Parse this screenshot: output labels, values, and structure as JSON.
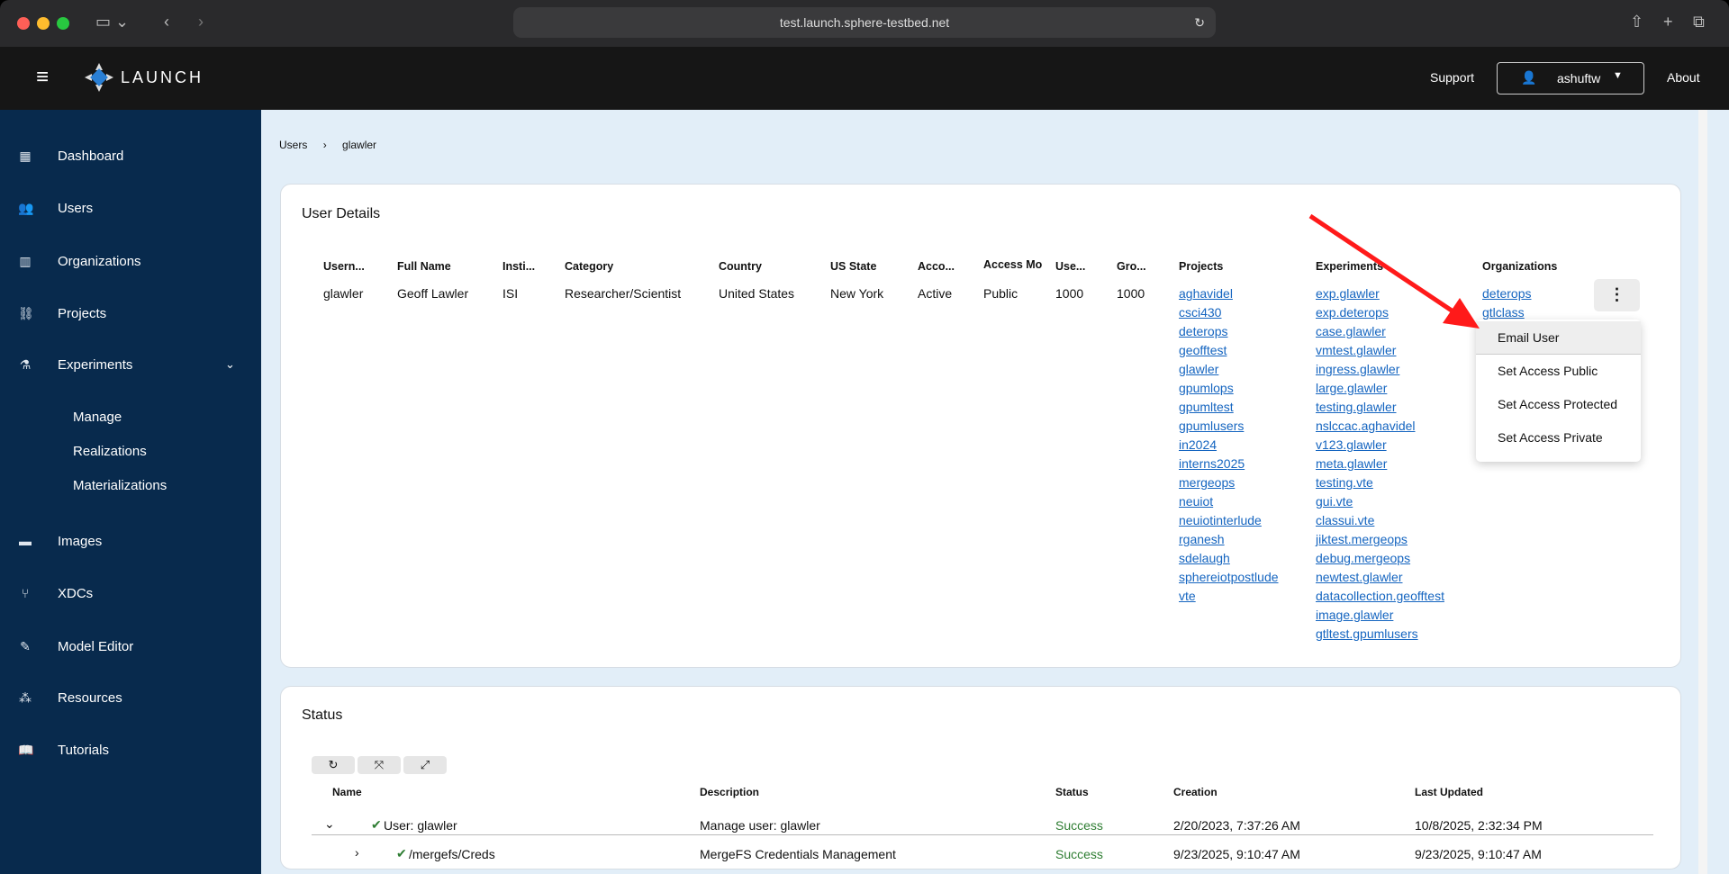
{
  "browser": {
    "url": "test.launch.sphere-testbed.net"
  },
  "topbar": {
    "brand": "LAUNCH",
    "support": "Support",
    "user": "ashuftw",
    "about": "About"
  },
  "sidebar": {
    "items": [
      {
        "label": "Dashboard",
        "icon": "dashboard-icon"
      },
      {
        "label": "Users",
        "icon": "users-icon"
      },
      {
        "label": "Organizations",
        "icon": "building-icon"
      },
      {
        "label": "Projects",
        "icon": "project-icon"
      },
      {
        "label": "Experiments",
        "icon": "flask-icon"
      },
      {
        "label": "Images",
        "icon": "drive-icon"
      },
      {
        "label": "XDCs",
        "icon": "branch-icon"
      },
      {
        "label": "Model Editor",
        "icon": "edit-icon"
      },
      {
        "label": "Resources",
        "icon": "resources-icon"
      },
      {
        "label": "Tutorials",
        "icon": "book-icon"
      }
    ],
    "experiments_sub": [
      "Manage",
      "Realizations",
      "Materializations"
    ]
  },
  "breadcrumb": {
    "parent": "Users",
    "current": "glawler"
  },
  "user_details": {
    "title": "User Details",
    "headers": [
      "Usern...",
      "Full Name",
      "Insti...",
      "Category",
      "Country",
      "US State",
      "Acco...",
      "Access Mo",
      "Use...",
      "Gro...",
      "Projects",
      "Experiments",
      "Organizations"
    ],
    "values": [
      "glawler",
      "Geoff Lawler",
      "ISI",
      "Researcher/Scientist",
      "United States",
      "New York",
      "Active",
      "Public",
      "1000",
      "1000"
    ],
    "projects": [
      "aghavidel",
      "csci430",
      "deterops",
      "geofftest",
      "glawler",
      "gpumlops",
      "gpumltest",
      "gpumlusers",
      "in2024",
      "interns2025",
      "mergeops",
      "neuiot",
      "neuiotinterlude",
      "rganesh",
      "sdelaugh",
      "sphereiotpostlude",
      "vte"
    ],
    "experiments": [
      "exp.glawler",
      "exp.deterops",
      "case.glawler",
      "vmtest.glawler",
      "ingress.glawler",
      "large.glawler",
      "testing.glawler",
      "nslccac.aghavidel",
      "v123.glawler",
      "meta.glawler",
      "testing.vte",
      "gui.vte",
      "classui.vte",
      "jiktest.mergeops",
      "debug.mergeops",
      "newtest.glawler",
      "datacollection.geofftest",
      "image.glawler",
      "gtltest.gpumlusers"
    ],
    "organizations": [
      "deterops",
      "gtlclass"
    ]
  },
  "menu": {
    "items": [
      "Email User",
      "Set Access Public",
      "Set Access Protected",
      "Set Access Private"
    ]
  },
  "status": {
    "title": "Status",
    "headers": [
      "Name",
      "Description",
      "Status",
      "Creation",
      "Last Updated"
    ],
    "rows": [
      {
        "name": "User: glawler",
        "description": "Manage user: glawler",
        "status": "Success",
        "creation": "2/20/2023, 7:37:26 AM",
        "updated": "10/8/2025, 2:32:34 PM"
      },
      {
        "name": "/mergefs/Creds",
        "description": "MergeFS Credentials Management",
        "status": "Success",
        "creation": "9/23/2025, 9:10:47 AM",
        "updated": "9/23/2025, 9:10:47 AM"
      }
    ]
  },
  "colors": {
    "sidebar": "#082a4d",
    "topbar": "#161616",
    "link": "#1565c0",
    "success": "#2e7d32",
    "arrow": "#ff1a1a"
  }
}
